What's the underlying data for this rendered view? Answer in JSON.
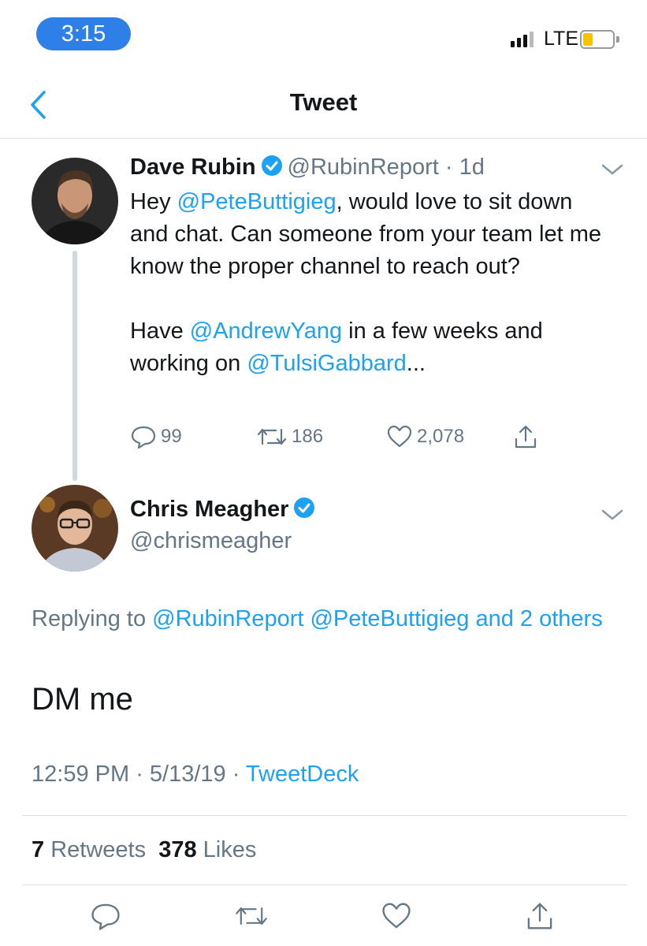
{
  "status_bar": {
    "time": "3:15",
    "network": "LTE"
  },
  "nav": {
    "title": "Tweet"
  },
  "original_tweet": {
    "author_name": "Dave Rubin",
    "author_handle": "@RubinReport",
    "age": "1d",
    "text_1_a": "Hey ",
    "mention_1": "@PeteButtigieg",
    "text_1_b": ", would love to sit down and chat. Can someone from your team let me know the proper channel to reach out?",
    "text_2_a": "Have ",
    "mention_2": "@AndrewYang",
    "text_2_b": " in a few weeks and working on ",
    "mention_3": "@TulsiGabbard",
    "text_2_c": "...",
    "replies": "99",
    "retweets": "186",
    "likes": "2,078"
  },
  "reply_tweet": {
    "author_name": "Chris Meagher",
    "author_handle": "@chrismeagher",
    "replying_prefix": "Replying to ",
    "replying_to": "@RubinReport @PeteButtigieg and 2 others",
    "body": "DM me",
    "time": "12:59 PM",
    "date": "5/13/19",
    "source": "TweetDeck",
    "retweets_count": "7",
    "retweets_label": "Retweets",
    "likes_count": "378",
    "likes_label": "Likes"
  },
  "colors": {
    "accent": "#1da1f2",
    "secondary_text": "#657786",
    "time_pill": "#2f7fe8"
  },
  "icons": [
    "back-chevron-icon",
    "verified-badge-icon",
    "chevron-down-icon",
    "reply-icon",
    "retweet-icon",
    "like-icon",
    "share-icon"
  ]
}
